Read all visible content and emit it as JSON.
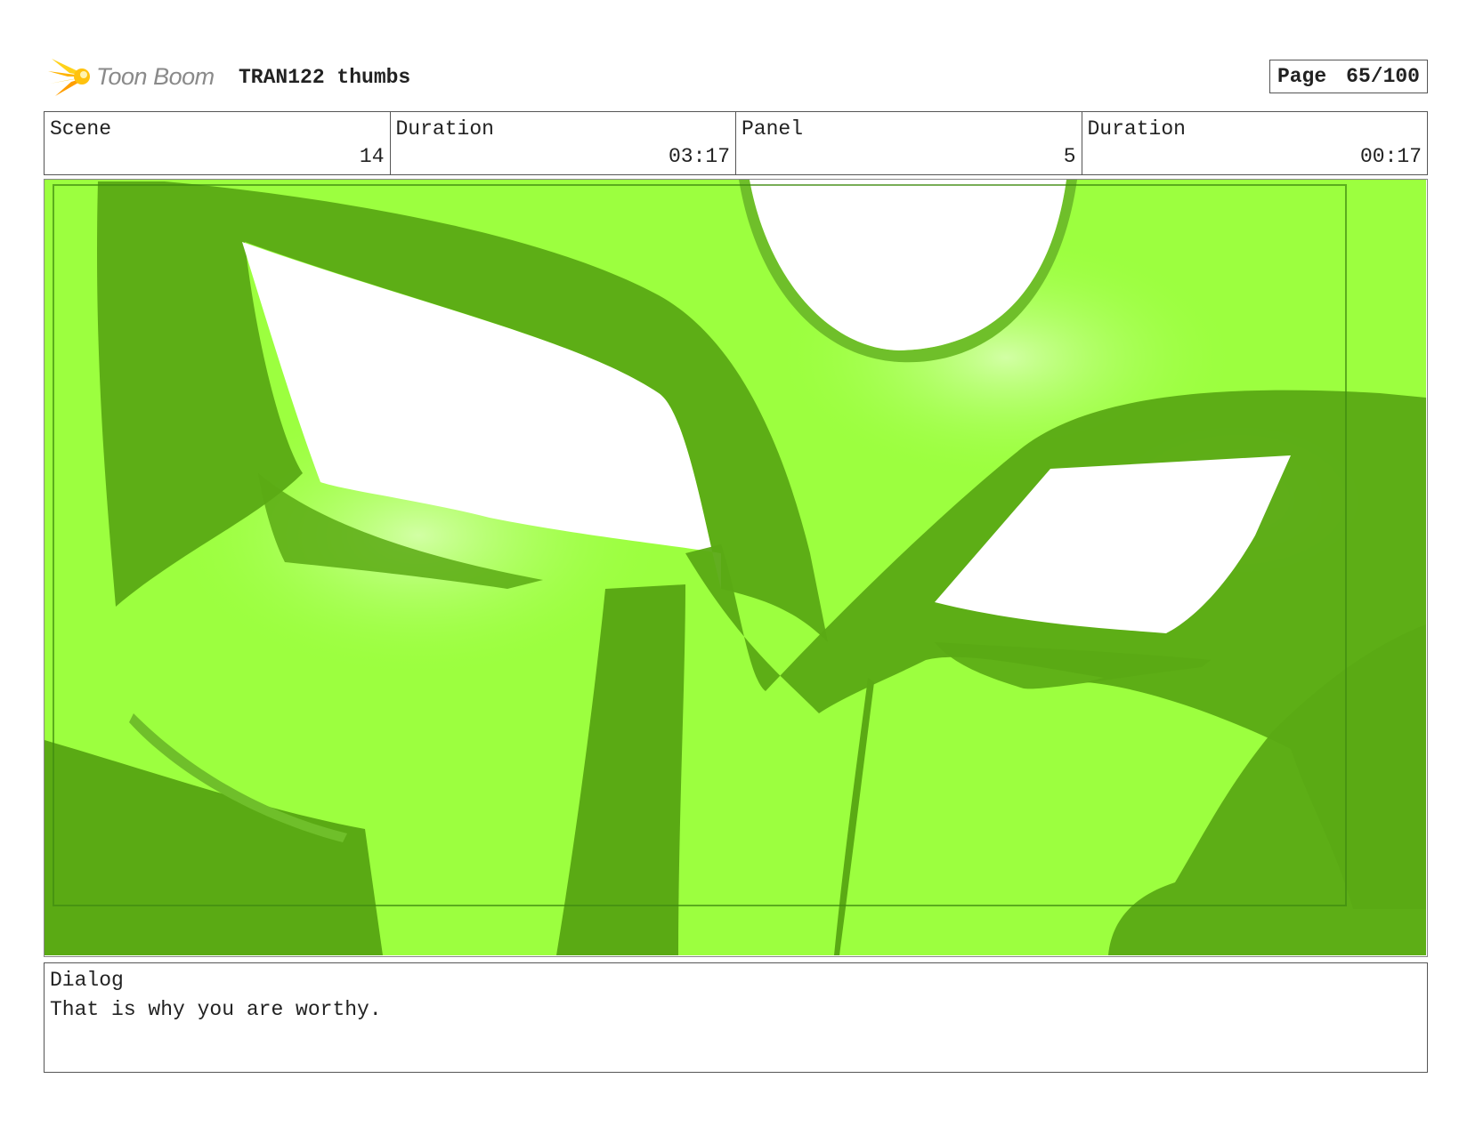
{
  "header": {
    "brand": "Toon Boom",
    "project_title": "TRAN122 thumbs",
    "page_label": "Page",
    "page_value": "65/100"
  },
  "info": {
    "scene_label": "Scene",
    "scene_value": "14",
    "scene_duration_label": "Duration",
    "scene_duration_value": "03:17",
    "panel_label": "Panel",
    "panel_value": "5",
    "panel_duration_label": "Duration",
    "panel_duration_value": "00:17"
  },
  "panel_image": {
    "colors": {
      "bright_green": "#9cff3f",
      "dark_green": "#5aaa14",
      "highlight": "#c8ff90",
      "white": "#ffffff"
    }
  },
  "dialog": {
    "label": "Dialog",
    "text": "That is why you are worthy."
  },
  "icons": {
    "logo": "toon-boom-logo-icon"
  }
}
